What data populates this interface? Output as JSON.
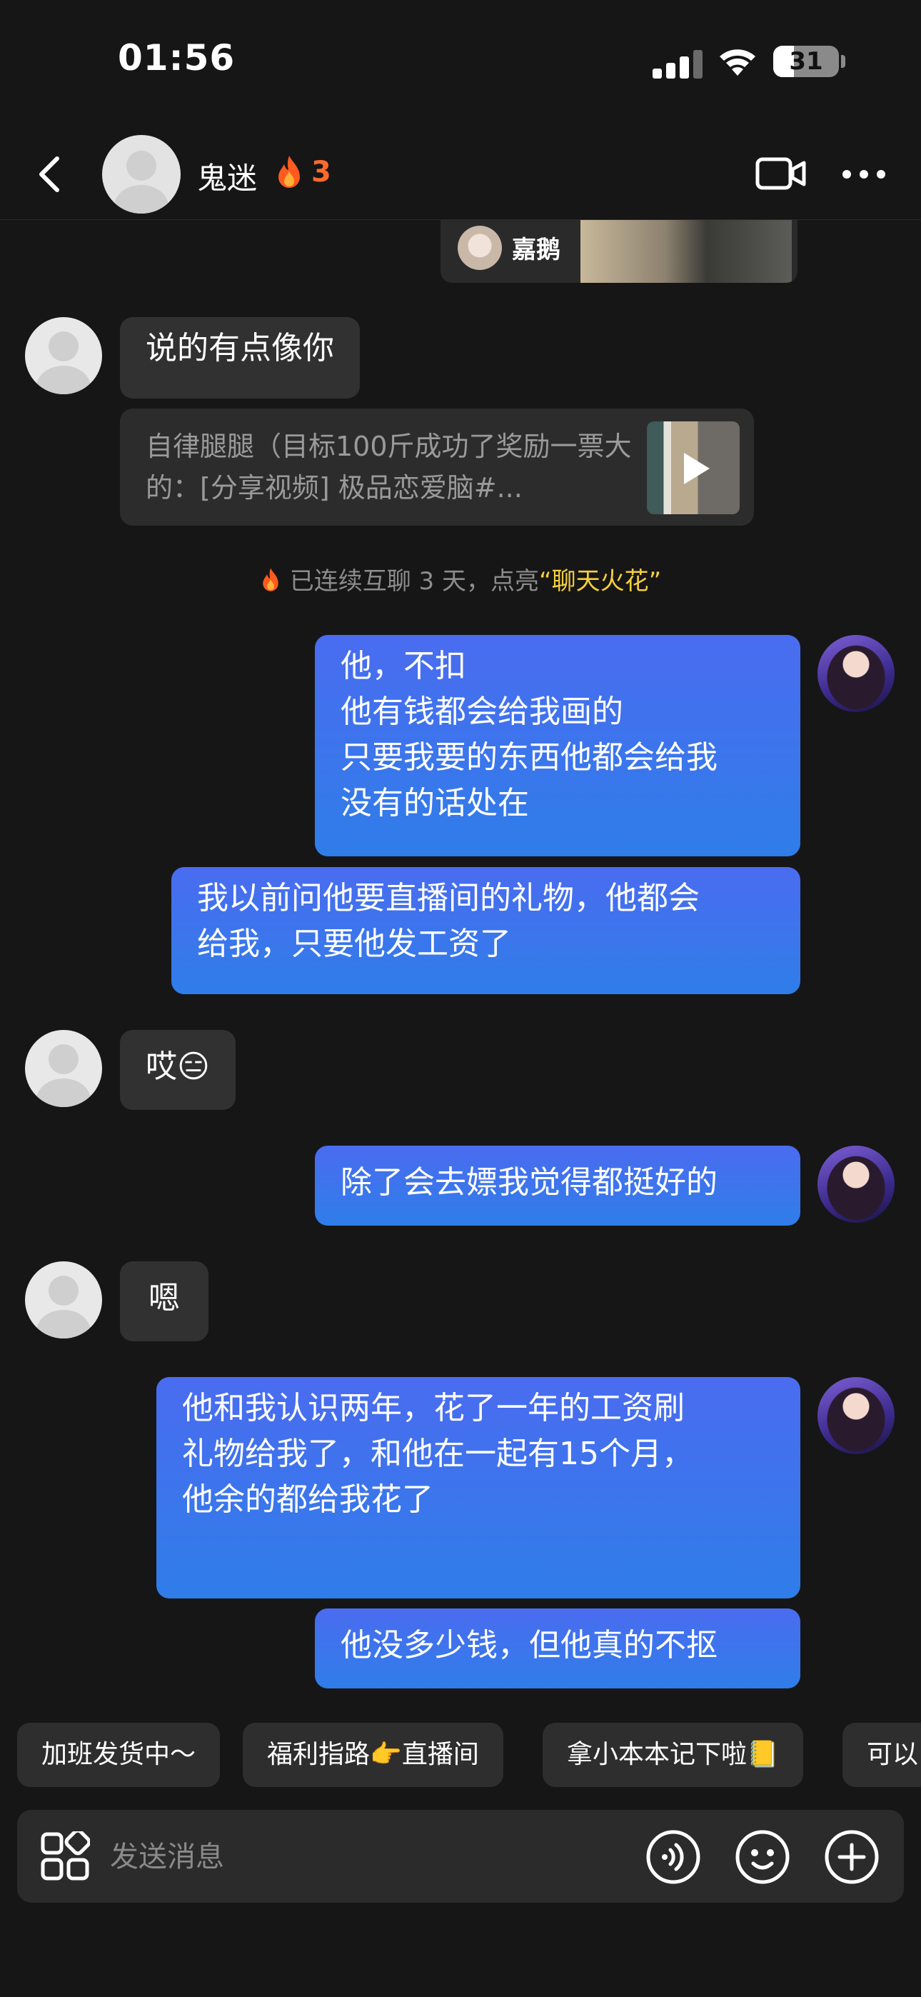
{
  "status_bar": {
    "time": "01:56",
    "battery": "31",
    "battery_level": 0.31
  },
  "header": {
    "contact_name": "鬼迷",
    "streak": "3"
  },
  "shared_card": {
    "name": "嘉鹅"
  },
  "messages": {
    "m1": "说的有点像你",
    "link_text": "自律腿腿（目标100斤成功了奖励一票大的：[分享视频] 极品恋爱脑#...",
    "system_prefix": "已连续互聊 3 天，点亮",
    "system_highlight": "“聊天火花”",
    "m2": "他，不扣\n他有钱都会给我画的\n只要我要的东西他都会给我\n没有的话处在",
    "m3": "我以前问他要直播间的礼物，他都会\n给我，只要他发工资了",
    "m4": "哎😑",
    "m5": "除了会去嫖我觉得都挺好的",
    "m6": "嗯",
    "m7": "他和我认识两年，花了一年的工资刷\n礼物给我了，和他在一起有15个月，\n他余的都给我花了",
    "m8": "他没多少钱，但他真的不抠"
  },
  "quick_replies": [
    "加班发货中～",
    "福利指路👉直播间",
    "拿小本本记下啦📒",
    "可以"
  ],
  "input": {
    "placeholder": "发送消息"
  },
  "colors": {
    "outgoing_bubble": "#3f74ee",
    "incoming_bubble": "#313131",
    "streak": "#ff6a2c",
    "highlight": "#f6cf3c"
  }
}
